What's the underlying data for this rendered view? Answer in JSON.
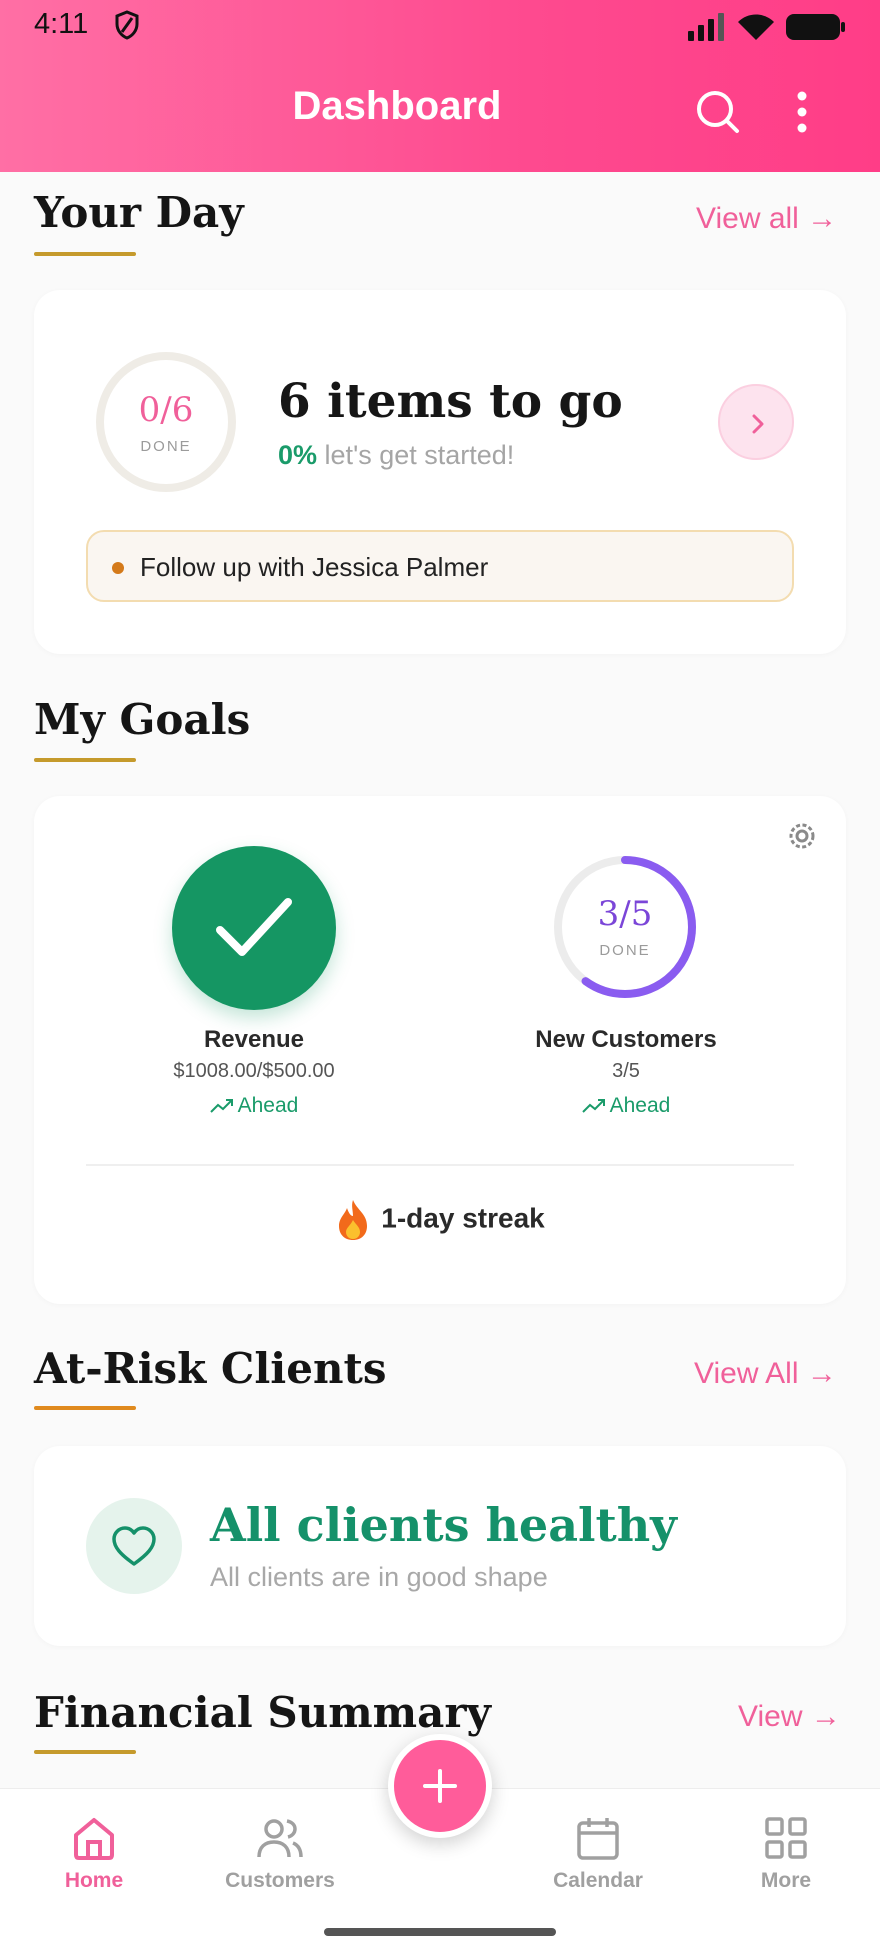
{
  "status_bar": {
    "time": "4:11"
  },
  "header": {
    "title": "Dashboard"
  },
  "your_day": {
    "title": "Your Day",
    "view_all": "View all →",
    "progress_count": "0/6",
    "progress_done": "DONE",
    "progress_fraction": 0,
    "items_to_go": "6 items to go",
    "percent": "0%",
    "message": "let's get started!",
    "task": "Follow up with Jessica Palmer"
  },
  "my_goals": {
    "title": "My Goals",
    "goals": [
      {
        "name": "Revenue",
        "value": "$1008.00/$500.00",
        "status": "Ahead",
        "complete": true
      },
      {
        "name": "New Customers",
        "value": "3/5",
        "status": "Ahead",
        "ring_count": "3/5",
        "ring_done": "DONE",
        "progress_fraction": 0.6
      }
    ],
    "streak": "1-day streak"
  },
  "at_risk": {
    "title": "At-Risk Clients",
    "view_all": "View All →",
    "healthy_title": "All clients healthy",
    "healthy_subtitle": "All clients are in good shape"
  },
  "financial": {
    "title": "Financial Summary",
    "view": "View →"
  },
  "bottom_nav": {
    "items": [
      {
        "label": "Home",
        "icon": "home-icon",
        "active": true
      },
      {
        "label": "Customers",
        "icon": "users-icon"
      },
      {
        "label": "Calendar",
        "icon": "calendar-icon"
      },
      {
        "label": "More",
        "icon": "grid-icon"
      }
    ],
    "fab_icon": "plus-icon"
  },
  "colors": {
    "accent": "#f0609a",
    "success": "#159663",
    "purple": "#8a5cf0",
    "gold": "#c59a2c"
  }
}
